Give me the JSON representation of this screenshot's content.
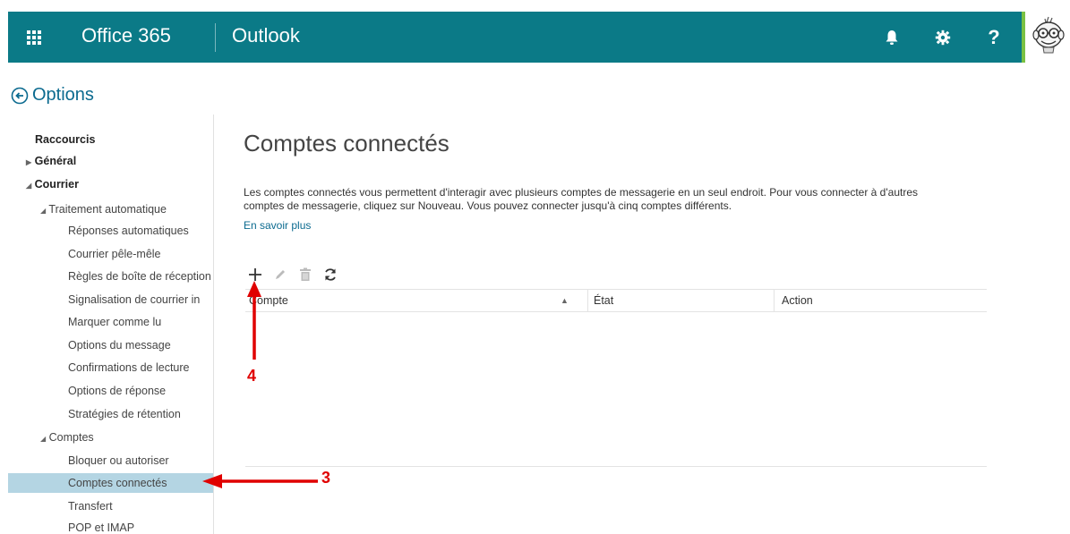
{
  "header": {
    "brand": "Office 365",
    "app": "Outlook",
    "icons": [
      "app-launcher-icon",
      "bell-icon",
      "gear-icon",
      "help-icon"
    ],
    "help_label": "?",
    "colors": {
      "bar": "#0b7a87",
      "accent": "#7ac143"
    }
  },
  "options_title": "Options",
  "sidebar": {
    "items": [
      {
        "label": "Raccourcis"
      },
      {
        "label": "Général"
      },
      {
        "label": "Courrier"
      },
      {
        "label": "Traitement automatique"
      },
      {
        "label": "Réponses automatiques"
      },
      {
        "label": "Courrier pêle-mêle"
      },
      {
        "label": "Règles de boîte de réception"
      },
      {
        "label": "Signalisation de courrier in"
      },
      {
        "label": "Marquer comme lu"
      },
      {
        "label": "Options du message"
      },
      {
        "label": "Confirmations de lecture"
      },
      {
        "label": "Options de réponse"
      },
      {
        "label": "Stratégies de rétention"
      },
      {
        "label": "Comptes"
      },
      {
        "label": "Bloquer ou autoriser"
      },
      {
        "label": "Comptes connectés"
      },
      {
        "label": "Transfert"
      },
      {
        "label": "POP et IMAP"
      }
    ],
    "selected": "Comptes connectés"
  },
  "main": {
    "title": "Comptes connectés",
    "description": "Les comptes connectés vous permettent d'interagir avec plusieurs comptes de messagerie en un seul endroit. Pour vous connecter à d'autres comptes de messagerie, cliquez sur Nouveau. Vous pouvez connecter jusqu'à cinq comptes différents.",
    "learn_more": "En savoir plus",
    "toolbar": [
      "plus-icon",
      "pencil-icon",
      "trash-icon",
      "refresh-icon"
    ],
    "table": {
      "columns": [
        "Compte",
        "État",
        "Action"
      ],
      "rows": []
    }
  },
  "annotations": {
    "arrow_3_label": "3",
    "arrow_4_label": "4",
    "color": "#e00000"
  }
}
